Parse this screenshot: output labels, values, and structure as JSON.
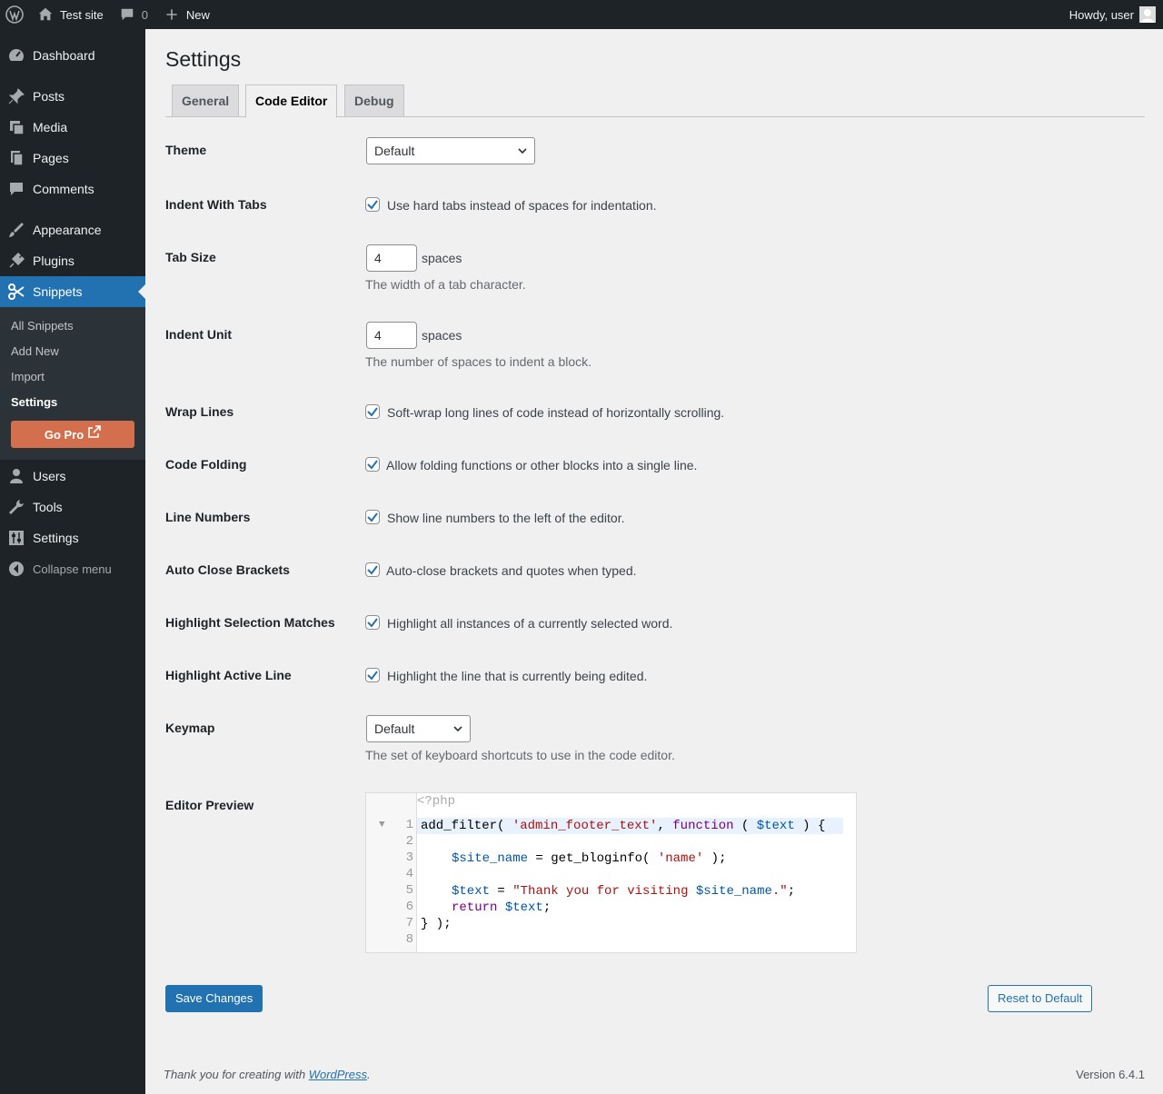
{
  "adminbar": {
    "site_name": "Test site",
    "comments_count": "0",
    "new_label": "New",
    "greeting": "Howdy, user"
  },
  "menu": {
    "dashboard": "Dashboard",
    "posts": "Posts",
    "media": "Media",
    "pages": "Pages",
    "comments": "Comments",
    "appearance": "Appearance",
    "plugins": "Plugins",
    "snippets": "Snippets",
    "submenu": {
      "all_snippets": "All Snippets",
      "add_new": "Add New",
      "import": "Import",
      "settings": "Settings",
      "go_pro": "Go Pro"
    },
    "users": "Users",
    "tools": "Tools",
    "settings": "Settings",
    "collapse": "Collapse menu"
  },
  "page": {
    "title": "Settings",
    "tabs": [
      "General",
      "Code Editor",
      "Debug"
    ],
    "active_tab": "Code Editor"
  },
  "settings": {
    "theme": {
      "label": "Theme",
      "value": "Default"
    },
    "indent_with_tabs": {
      "label": "Indent With Tabs",
      "checked": true,
      "text": "Use hard tabs instead of spaces for indentation."
    },
    "tab_size": {
      "label": "Tab Size",
      "value": "4",
      "unit": "spaces",
      "description": "The width of a tab character."
    },
    "indent_unit": {
      "label": "Indent Unit",
      "value": "4",
      "unit": "spaces",
      "description": "The number of spaces to indent a block."
    },
    "wrap_lines": {
      "label": "Wrap Lines",
      "checked": true,
      "text": "Soft-wrap long lines of code instead of horizontally scrolling."
    },
    "code_folding": {
      "label": "Code Folding",
      "checked": true,
      "text": "Allow folding functions or other blocks into a single line."
    },
    "line_numbers": {
      "label": "Line Numbers",
      "checked": true,
      "text": "Show line numbers to the left of the editor."
    },
    "auto_close": {
      "label": "Auto Close Brackets",
      "checked": true,
      "text": "Auto-close brackets and quotes when typed."
    },
    "highlight_matches": {
      "label": "Highlight Selection Matches",
      "checked": true,
      "text": "Highlight all instances of a currently selected word."
    },
    "highlight_active": {
      "label": "Highlight Active Line",
      "checked": true,
      "text": "Highlight the line that is currently being edited."
    },
    "keymap": {
      "label": "Keymap",
      "value": "Default",
      "description": "The set of keyboard shortcuts to use in the code editor."
    },
    "editor_preview": {
      "label": "Editor Preview"
    }
  },
  "code": {
    "header": "<?php",
    "line_numbers": [
      "1",
      "2",
      "3",
      "4",
      "5",
      "6",
      "7",
      "8"
    ],
    "l1": {
      "fn": "add_filter( ",
      "s": "'admin_footer_text'",
      "sep": ", ",
      "k": "function",
      "p1": " ( ",
      "v": "$text",
      "p2": " ) {"
    },
    "l3": {
      "v": "$site_name",
      "eq": " = get_bloginfo( ",
      "s": "'name'",
      "end": " );"
    },
    "l5": {
      "v": "$text",
      "eq": " = ",
      "s1": "\"Thank you for visiting ",
      "v2": "$site_name",
      "s2": ".\"",
      "end": ";"
    },
    "l6": {
      "k": "return",
      "v": " $text",
      "end": ";"
    },
    "l7": "} );"
  },
  "actions": {
    "save": "Save Changes",
    "reset": "Reset to Default"
  },
  "footer": {
    "thanks_prefix": "Thank you for creating with ",
    "thanks_link": "WordPress",
    "thanks_suffix": ".",
    "version": "Version 6.4.1"
  },
  "colors": {
    "accent": "#2271b1",
    "menu_bg": "#1d2327",
    "go_pro": "#d46f4d"
  }
}
